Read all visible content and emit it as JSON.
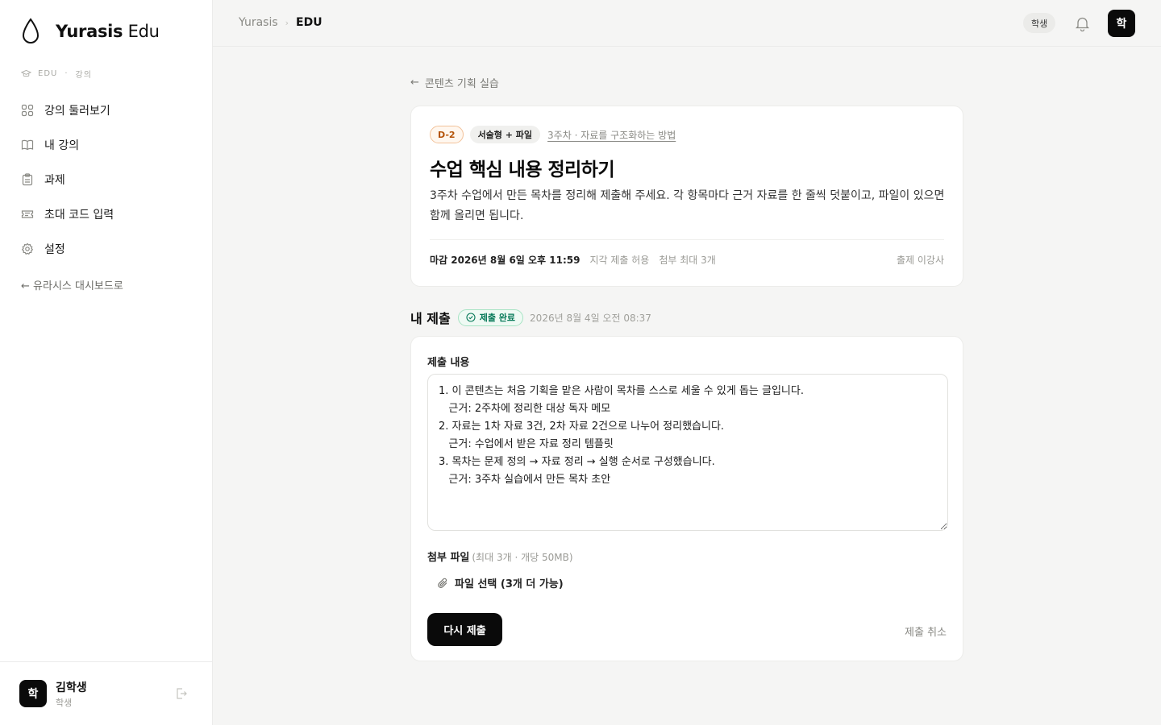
{
  "app": {
    "brand_bold": "Yurasis",
    "brand_light": "Edu"
  },
  "sidebar": {
    "context_left": "EDU",
    "context_dot": "·",
    "context_right": "강의",
    "items": [
      {
        "label": "강의 둘러보기",
        "icon": "grid-icon"
      },
      {
        "label": "내 강의",
        "icon": "book-icon"
      },
      {
        "label": "과제",
        "icon": "clipboard-icon"
      },
      {
        "label": "초대 코드 입력",
        "icon": "ticket-icon"
      },
      {
        "label": "설정",
        "icon": "gear-icon"
      }
    ],
    "back_link": "← 유라시스 대시보드로",
    "user": {
      "avatar": "학",
      "name": "김학생",
      "role": "학생"
    }
  },
  "topbar": {
    "breadcrumb_root": "Yurasis",
    "breadcrumb_sep": "›",
    "breadcrumb_current": "EDU",
    "role_pill": "학생",
    "avatar": "학"
  },
  "assignment": {
    "back_label": "콘텐츠 기획 실습",
    "dday": "D-2",
    "type": "서술형 + 파일",
    "week": "3주차 · 자료를 구조화하는 방법",
    "title": "수업 핵심 내용 정리하기",
    "description": "3주차 수업에서 만든 목차를 정리해 제출해 주세요. 각 항목마다 근거 자료를 한 줄씩 덧붙이고, 파일이 있으면 함께 올리면 됩니다.",
    "deadline": "마감 2026년 8월 6일 오후 11:59",
    "late_policy": "지각 제출 허용",
    "attach_limit": "첨부 최대 3개",
    "author": "출제 이강사"
  },
  "submission": {
    "title": "내 제출",
    "status": "제출 완료",
    "submitted_at": "2026년 8월 4일 오전 08:37",
    "content_label": "제출 내용",
    "content": "1. 이 콘텐츠는 처음 기획을 맡은 사람이 목차를 스스로 세울 수 있게 돕는 글입니다.\n   근거: 2주차에 정리한 대상 독자 메모\n2. 자료는 1차 자료 3건, 2차 자료 2건으로 나누어 정리했습니다.\n   근거: 수업에서 받은 자료 정리 템플릿\n3. 목차는 문제 정의 → 자료 정리 → 실행 순서로 구성했습니다.\n   근거: 3주차 실습에서 만든 목차 초안",
    "attach_label": "첨부 파일",
    "attach_hint": "(최대 3개 · 개당 50MB)",
    "file_button": "파일 선택 (3개 더 가능)",
    "resubmit": "다시 제출",
    "cancel": "제출 취소"
  },
  "colors": {
    "accent": "#0a0a0a",
    "deadline_badge": "#b45309",
    "success": "#047857"
  }
}
